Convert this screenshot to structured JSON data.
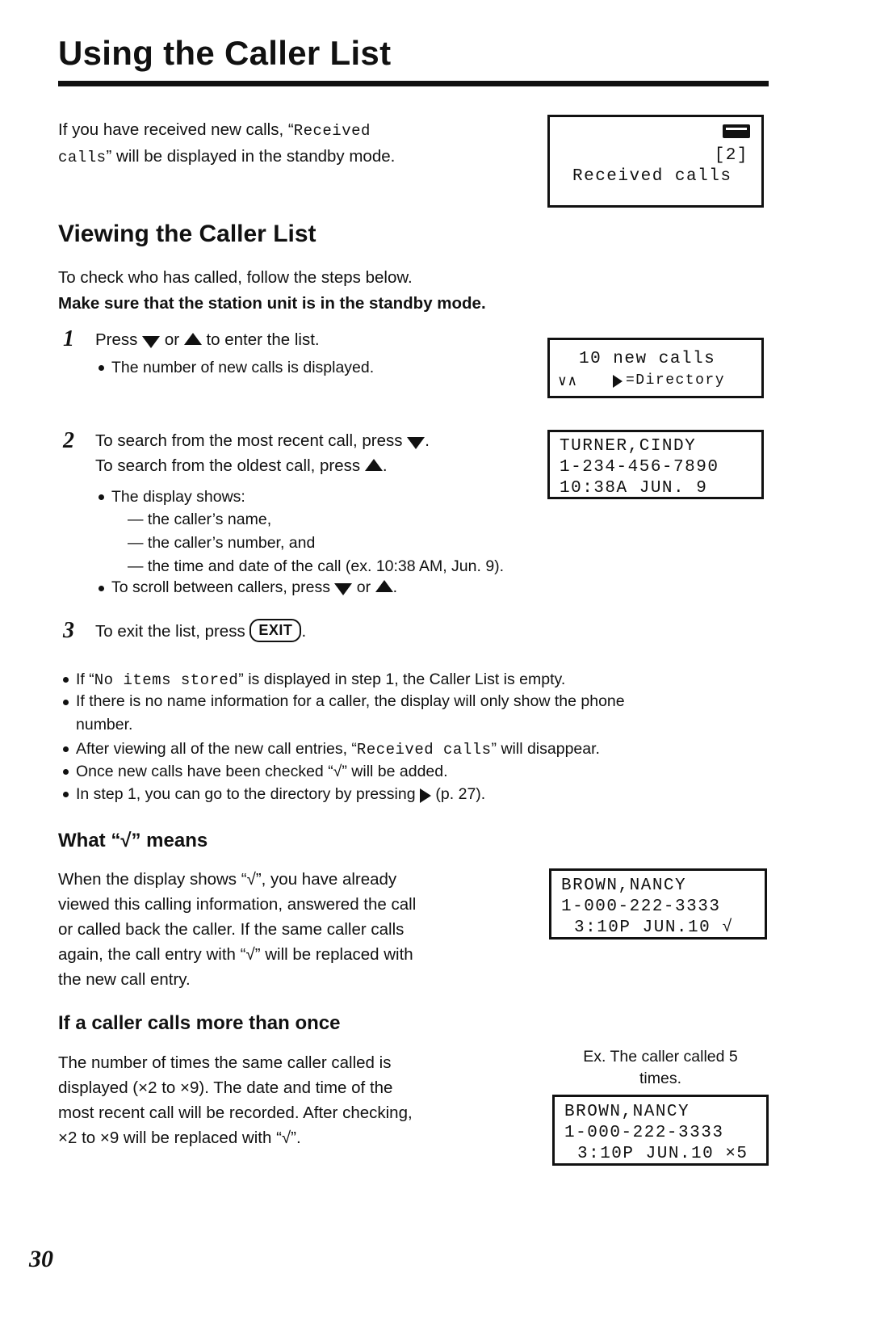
{
  "page": {
    "title": "Using the Caller List",
    "number": "30"
  },
  "intro": {
    "line1_a": "If you have received new calls, “",
    "line1_mono": "Received",
    "line2_mono": "calls",
    "line2_b": "” will be displayed in the standby mode."
  },
  "lcd_standby": {
    "icon": "antenna-icon",
    "line1": "[2]",
    "line2": "Received calls"
  },
  "viewing": {
    "heading": "Viewing the Caller List",
    "intro": "To check who has called, follow the steps below.",
    "intro_bold": "Make sure that the station unit is in the standby mode."
  },
  "steps": [
    {
      "num": "1",
      "text_a": "Press",
      "text_b": "or",
      "text_c": "to enter the list.",
      "bullets": [
        "The number of new calls is displayed."
      ]
    },
    {
      "num": "2",
      "text_line1_a": "To search from the most recent call, press",
      "text_line1_b": ".",
      "text_line2_a": "To search from the oldest call, press",
      "text_line2_b": ".",
      "bullet1": "The display shows:",
      "dashes": [
        "— the caller’s name,",
        "— the caller’s number, and",
        "— the time and date of the call (ex. 10:38 AM, Jun. 9)."
      ],
      "bullet2_a": "To scroll between callers, press",
      "bullet2_b": "or",
      "bullet2_c": "."
    },
    {
      "num": "3",
      "text_a": "To exit the list, press",
      "key": "EXIT",
      "text_b": "."
    }
  ],
  "lcd_newcalls": {
    "line1": "10 new calls",
    "line2_left": "∨∧",
    "line2_right": "=Directory"
  },
  "lcd_turner": {
    "line1": "TURNER,CINDY",
    "line2": "1-234-456-7890",
    "line3": "10:38A JUN. 9"
  },
  "notes": [
    {
      "a": "If “",
      "mono": "No items stored",
      "b": "” is displayed in step 1, the Caller List is empty."
    },
    {
      "a": "If there is no name information for a caller, the display will only show the phone",
      "b": "number."
    },
    {
      "a": "After viewing all of the new call entries, “",
      "mono": "Received calls",
      "b": "” will disappear."
    },
    {
      "a": "Once new calls have been checked “√” will be added."
    },
    {
      "a": "In step 1, you can go to the directory by pressing",
      "b": "(p. 27)."
    }
  ],
  "what_means": {
    "heading_a": "What “",
    "heading_check": "√",
    "heading_b": "” means",
    "body": [
      "When the display shows “√”, you have already",
      "viewed this calling information, answered the call",
      "or called back the caller. If the same caller calls",
      "again, the call entry with “√” will be replaced with",
      "the new call entry."
    ]
  },
  "lcd_brown1": {
    "line1": "BROWN,NANCY",
    "line2": "1-000-222-3333",
    "line3": "3:10P JUN.10 √"
  },
  "more_than_once": {
    "heading": "If a caller calls more than once",
    "body": [
      "The number of times the same caller called is",
      "displayed (×2 to ×9). The date and time of the",
      "most recent call will be recorded. After checking,",
      "×2 to ×9 will be replaced with “√”."
    ],
    "example_line1": "Ex. The caller called 5",
    "example_line2": "times."
  },
  "lcd_brown2": {
    "line1": "BROWN,NANCY",
    "line2": "1-000-222-3333",
    "line3": "3:10P JUN.10 ×5"
  }
}
